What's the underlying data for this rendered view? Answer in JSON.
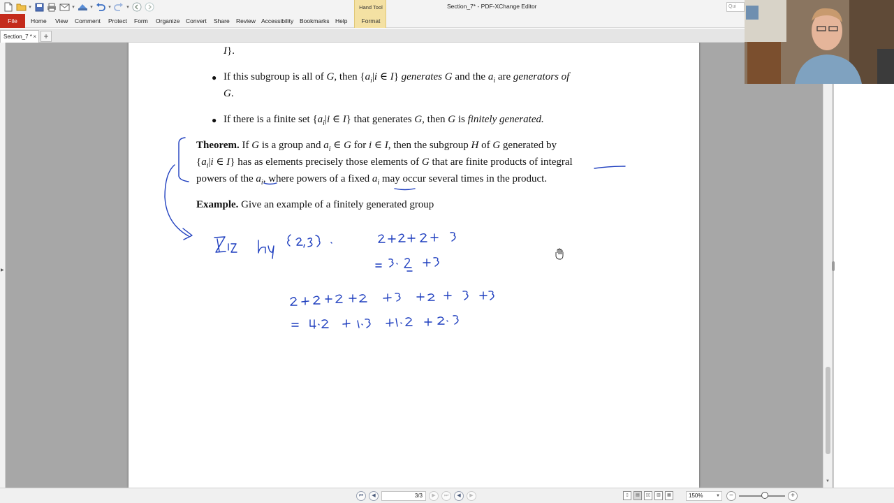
{
  "window": {
    "title": "Section_7* - PDF-XChange Editor",
    "search_placeholder": "Qui"
  },
  "ribbon": {
    "file_label": "File",
    "tabs": [
      "Home",
      "View",
      "Comment",
      "Protect",
      "Form",
      "Organize",
      "Convert",
      "Share",
      "Review",
      "Accessibility",
      "Bookmarks",
      "Help"
    ],
    "context_title": "Hand Tool",
    "context_tab": "Format"
  },
  "doc_tab": {
    "label": "Section_7 *",
    "close": "×",
    "new_tab": "+"
  },
  "document": {
    "prev_line_tail": "}.",
    "prev_line_var": "I",
    "b1": {
      "t1": "If this subgroup is all of ",
      "G1": "G",
      "t2": ", then {",
      "a": "a",
      "sub_i": "i",
      "t3": "|",
      "i1": "i",
      "t4": " ∈ ",
      "I1": "I",
      "t5": "} ",
      "gen": "generates",
      "t6": " ",
      "G2": "G",
      "t7": " and the ",
      "a2": "a",
      "sub_i2": "i",
      "t8": " are ",
      "genof": "generators of",
      "G3": "G",
      "t9": "."
    },
    "b2": {
      "t1": "If there is a finite set {",
      "a": "a",
      "sub_i": "i",
      "t2": "|",
      "i1": "i",
      "t3": " ∈ ",
      "I1": "I",
      "t4": "} that generates ",
      "G1": "G",
      "t5": ", then ",
      "G2": "G",
      "t6": " is ",
      "fg": "finitely generated."
    },
    "theorem": {
      "label": "Theorem.",
      "l1": {
        "t1": " If ",
        "G1": "G",
        "t2": " is a group and ",
        "a": "a",
        "sub_i": "i",
        "t3": " ∈ ",
        "G2": "G",
        "t4": " for ",
        "i1": "i",
        "t5": " ∈ ",
        "I1": "I",
        "t6": ", then the subgroup ",
        "H": "H",
        "t7": " of ",
        "G3": "G",
        "t8": " generated by"
      },
      "l2": {
        "t1": "{",
        "a": "a",
        "sub_i": "i",
        "t2": "|",
        "i1": "i",
        "t3": " ∈ ",
        "I1": "I",
        "t4": "} has as elements precisely those elements of ",
        "G1": "G",
        "t5": " that are finite products of integral"
      },
      "l3": {
        "t1": "powers of the ",
        "a": "a",
        "sub_i": "i",
        "t2": ", where powers of a fixed ",
        "a2": "a",
        "sub_i2": "i",
        "t3": " may occur several times in the product."
      }
    },
    "example": {
      "label": "Example.",
      "text": " Give an example of a finitely generated group"
    }
  },
  "status": {
    "page_indicator": "3/3",
    "zoom": "150%"
  },
  "colors": {
    "ink": "#1f3fbf",
    "file_tab": "#c42b1c",
    "context_tab": "#f4e1a3",
    "canvas_bg": "#a7a7a7"
  },
  "icons": {
    "qat": [
      "new-icon",
      "open-icon",
      "save-icon",
      "print-icon",
      "email-icon",
      "scan-icon",
      "undo-icon",
      "redo-icon",
      "back-icon",
      "forward-icon"
    ],
    "cursor": "hand-cursor-icon"
  }
}
